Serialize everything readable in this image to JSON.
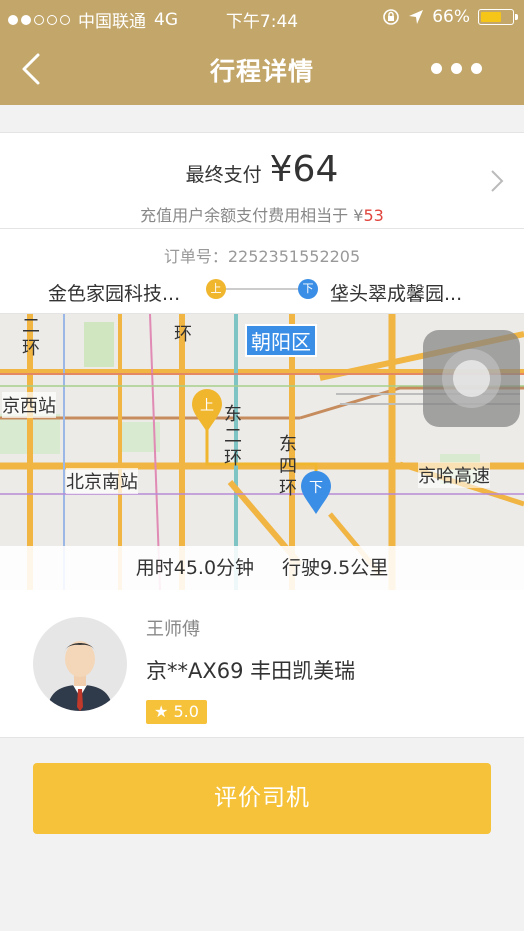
{
  "status_bar": {
    "carrier": "中国联通",
    "network": "4G",
    "time": "下午7:44",
    "battery": "66%",
    "battery_level": 0.66
  },
  "nav": {
    "title": "行程详情"
  },
  "payment": {
    "label": "最终支付",
    "amount": "¥64",
    "note_prefix": "充值用户余额支付费用相当于",
    "note_currency": "¥",
    "note_value": "53"
  },
  "route": {
    "order_number": "订单号：2252351552205",
    "from": "金色家园科技...",
    "to": "垡头翠成馨园...",
    "pickup_marker": "上",
    "dropoff_marker": "下"
  },
  "map": {
    "labels": [
      "朝阳区",
      "京西站",
      "北京南站",
      "东二环",
      "东四环",
      "京哈高速",
      "二环",
      "环"
    ],
    "duration": "用时45.0分钟",
    "distance": "行驶9.5公里"
  },
  "driver": {
    "name": "王师傅",
    "car": "京**AX69 丰田凯美瑞",
    "rating": "5.0"
  },
  "action": {
    "rate_driver_label": "评价司机"
  },
  "colors": {
    "header": "#c3a76a",
    "accent": "#f5c23a",
    "price_red": "#e0453d",
    "pickup": "#f0b62e",
    "dropoff": "#3a8ee6"
  }
}
